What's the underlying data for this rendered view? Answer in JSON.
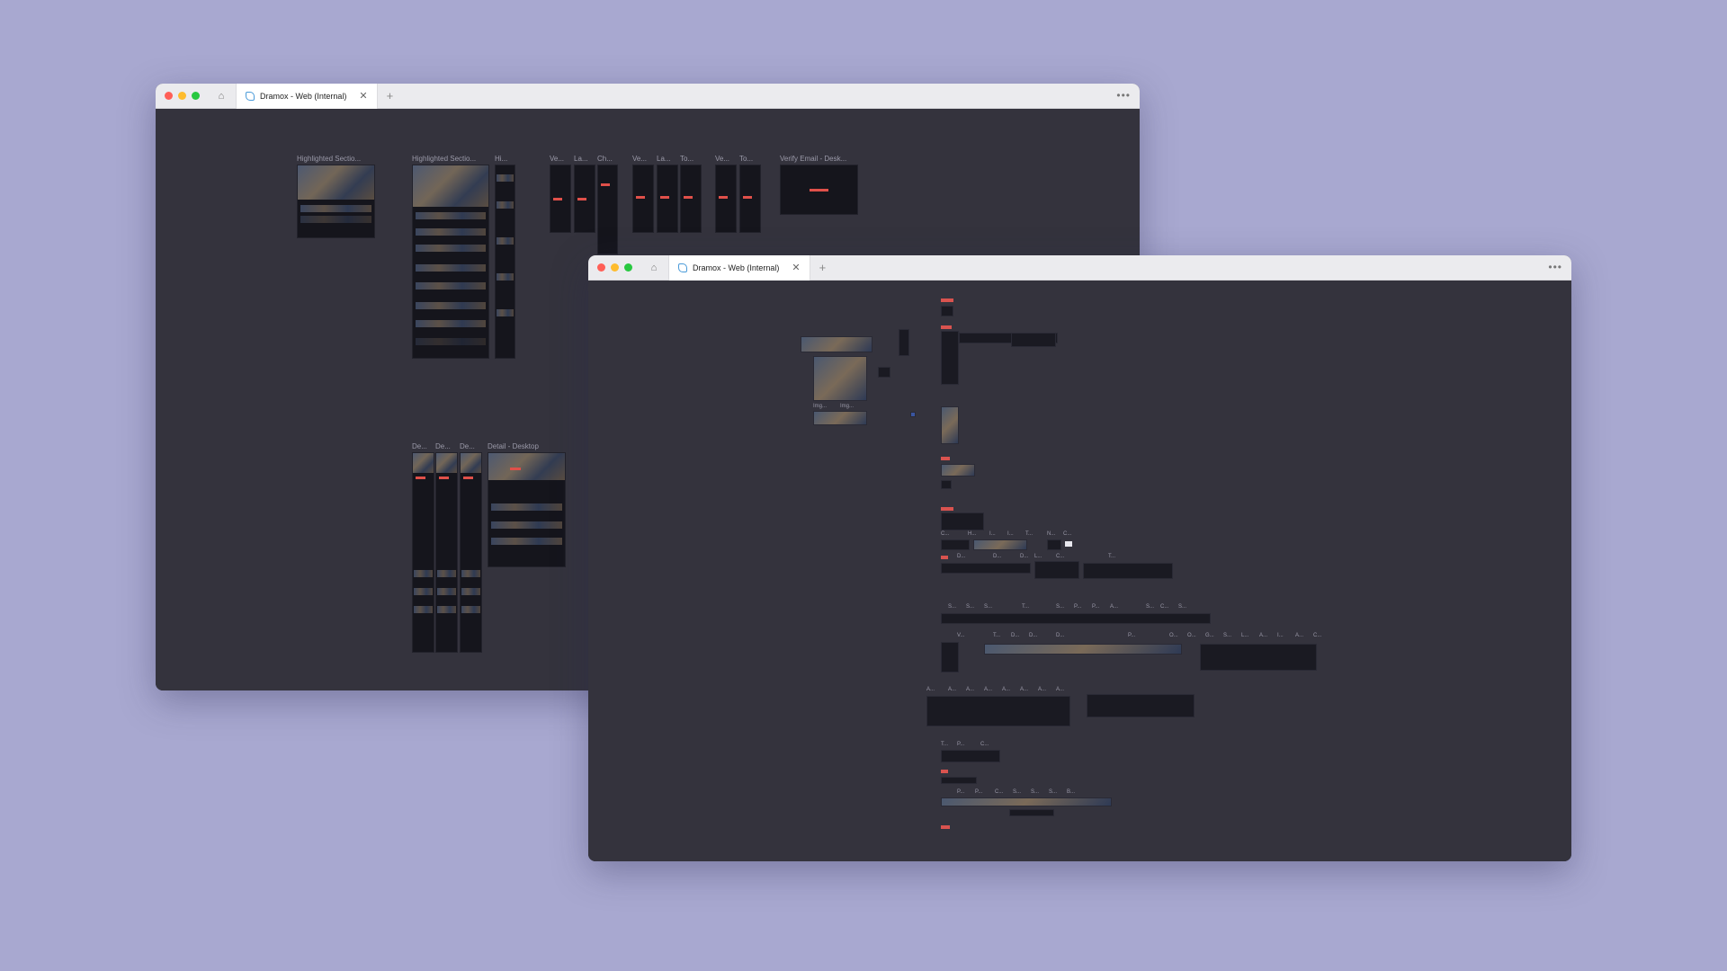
{
  "windows": [
    {
      "tab_title": "Dramox - Web (Internal)",
      "frame_labels": [
        "Highlighted Sectio...",
        "Highlighted Sectio...",
        "Hi...",
        "Ve...",
        "La...",
        "Ch...",
        "Ve...",
        "La...",
        "To...",
        "Ve...",
        "To...",
        "Verify Email - Desk...",
        "De...",
        "De...",
        "De...",
        "Detail - Desktop"
      ]
    },
    {
      "tab_title": "Dramox - Web (Internal)",
      "frame_labels": [
        "Img...",
        "Img...",
        "C...",
        "H...",
        "I...",
        "I...",
        "T...",
        "N...",
        "C...",
        "D...",
        "D...",
        "D...",
        "L...",
        "C...",
        "T...",
        "S...",
        "S...",
        "S...",
        "T...",
        "S...",
        "P...",
        "P...",
        "A...",
        "S...",
        "C...",
        "S...",
        "V...",
        "T...",
        "D...",
        "D...",
        "D...",
        "P...",
        "O...",
        "O...",
        "G...",
        "S...",
        "L...",
        "A...",
        "I...",
        "A...",
        "C...",
        "A...",
        "A...",
        "A...",
        "A...",
        "A...",
        "A...",
        "A...",
        "A...",
        "T...",
        "P...",
        "C...",
        "P...",
        "P...",
        "C...",
        "S...",
        "S...",
        "S...",
        "B..."
      ]
    }
  ]
}
